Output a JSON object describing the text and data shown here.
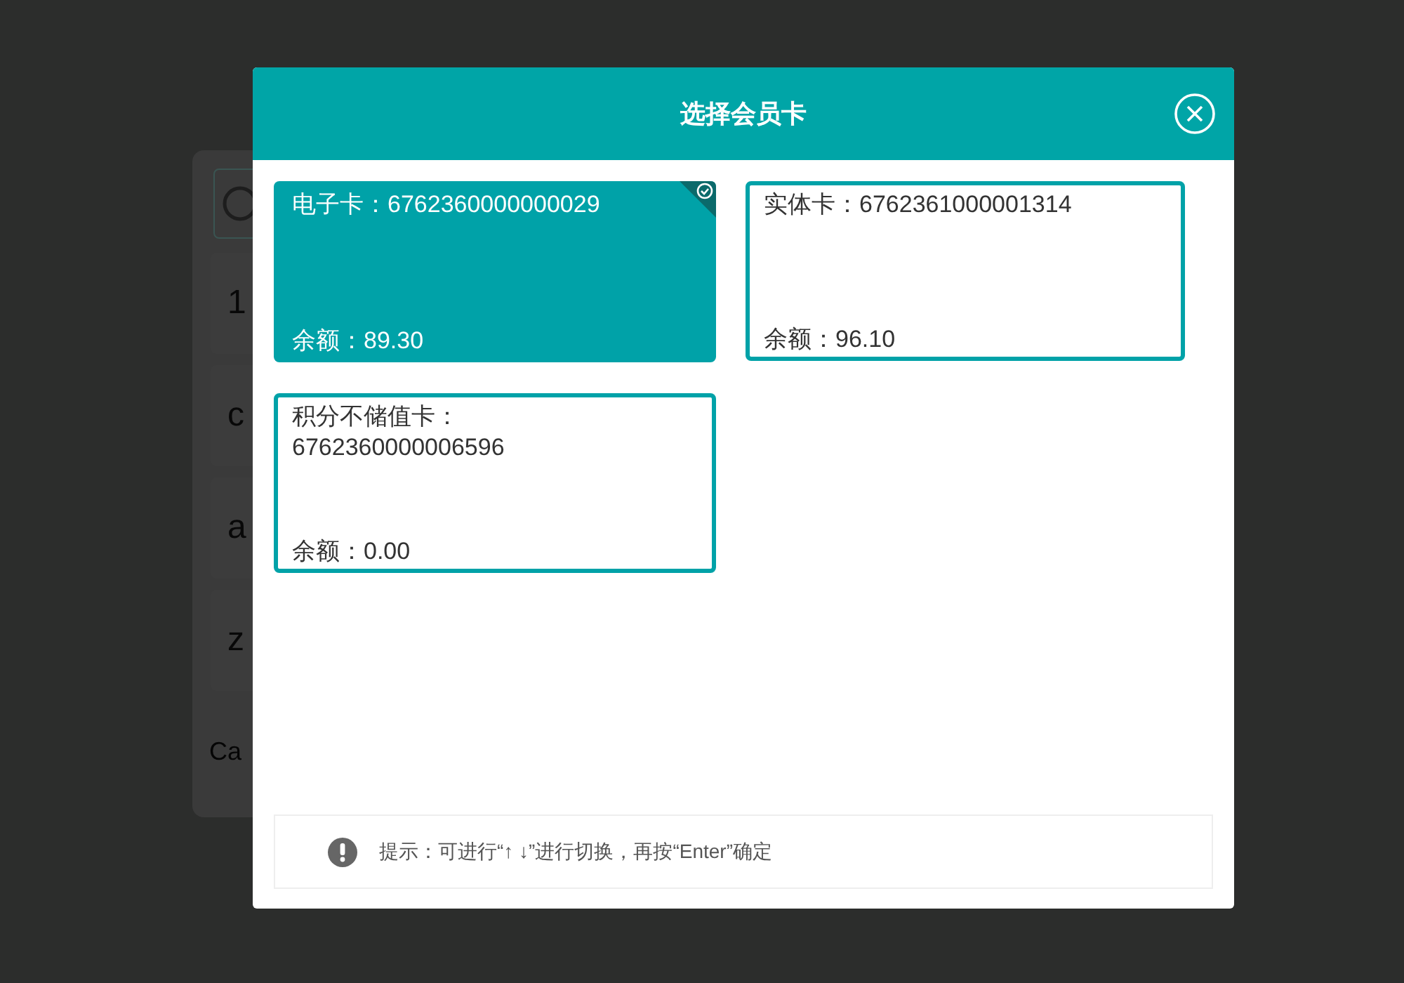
{
  "background_keys": [
    {
      "label": "1"
    },
    {
      "label": "c"
    },
    {
      "label": "a"
    },
    {
      "label": "z"
    }
  ],
  "background_caption": "Ca",
  "dialog": {
    "title": "选择会员卡",
    "cards": [
      {
        "name": "电子卡：6762360000000029",
        "balance": "余额：89.30",
        "selected": true
      },
      {
        "name": "实体卡：6762361000001314",
        "balance": "余额：96.10",
        "selected": false
      },
      {
        "name": "积分不储值卡：6762360000006596",
        "balance": "余额：0.00",
        "selected": false
      }
    ],
    "hint": "提示：可进行“↑ ↓”进行切换，再按“Enter”确定"
  }
}
